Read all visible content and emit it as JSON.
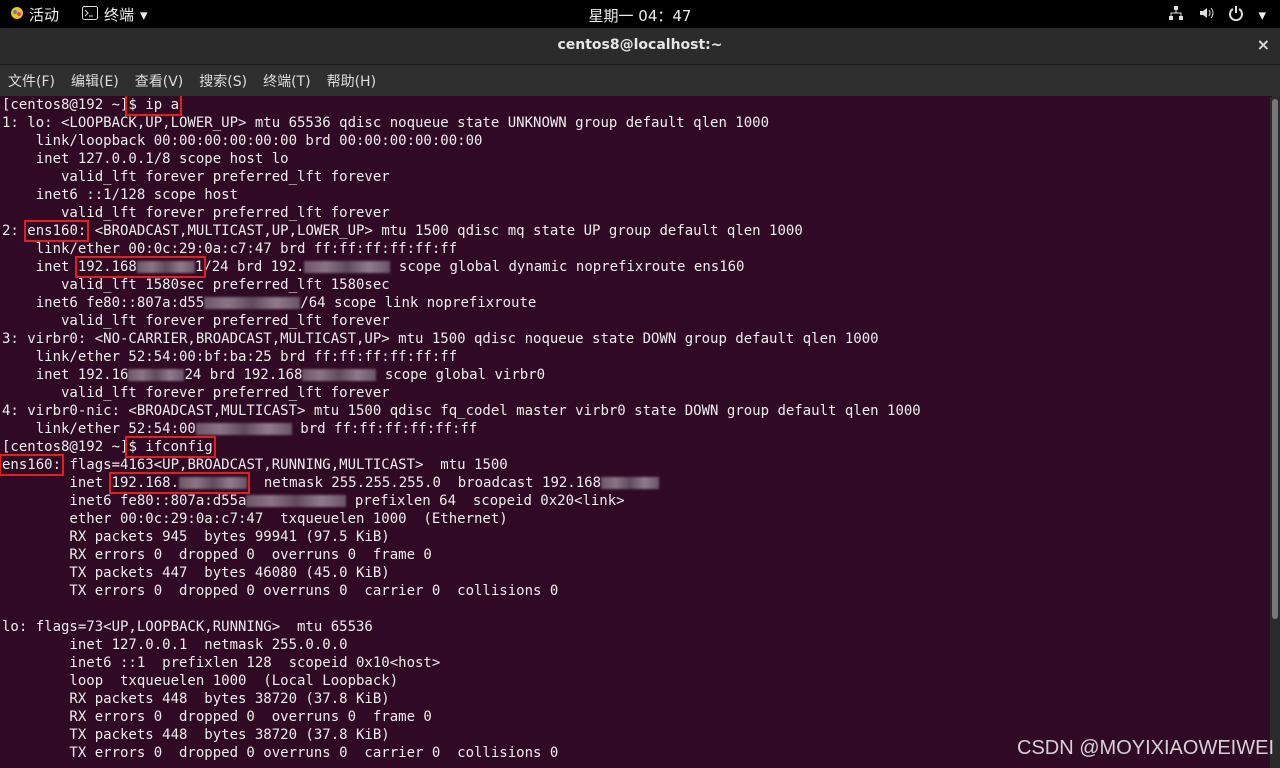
{
  "topbar": {
    "activities": "活动",
    "terminal_app": "终端",
    "clock": "星期一 04：47"
  },
  "window": {
    "title": "centos8@localhost:~",
    "close": "×"
  },
  "menu": [
    "文件(F)",
    "编辑(E)",
    "查看(V)",
    "搜索(S)",
    "终端(T)",
    "帮助(H)"
  ],
  "terminal": {
    "p1_prompt": "[centos8@192 ~]",
    "p1_cmd": "$ ip a",
    "l1": "1: lo: <LOOPBACK,UP,LOWER_UP> mtu 65536 qdisc noqueue state UNKNOWN group default qlen 1000",
    "l2": "    link/loopback 00:00:00:00:00:00 brd 00:00:00:00:00:00",
    "l3": "    inet 127.0.0.1/8 scope host lo",
    "l4": "       valid_lft forever preferred_lft forever",
    "l5": "    inet6 ::1/128 scope host",
    "l6": "       valid_lft forever preferred_lft forever",
    "l7a": "2: ",
    "l7b": "ens160:",
    "l7c": " <BROADCAST,MULTICAST,UP,LOWER_UP> mtu 1500 qdisc mq state UP group default qlen 1000",
    "l8": "    link/ether 00:0c:29:0a:c7:47 brd ff:ff:ff:ff:ff:ff",
    "l9a": "    inet ",
    "l9b": "192.168",
    "l9c": "1",
    "l9d": "/24 brd 192.",
    "l9e": " scope global dynamic noprefixroute ens160",
    "l10": "       valid_lft 1580sec preferred_lft 1580sec",
    "l11a": "    inet6 fe80::807a:d55",
    "l11b": "/64 scope link noprefixroute",
    "l12": "       valid_lft forever preferred_lft forever",
    "l13": "3: virbr0: <NO-CARRIER,BROADCAST,MULTICAST,UP> mtu 1500 qdisc noqueue state DOWN group default qlen 1000",
    "l14": "    link/ether 52:54:00:bf:ba:25 brd ff:ff:ff:ff:ff:ff",
    "l15a": "    inet 192.16",
    "l15b": "24 brd 192.168",
    "l15c": " scope global virbr0",
    "l16": "       valid_lft forever preferred_lft forever",
    "l17": "4: virbr0-nic: <BROADCAST,MULTICAST> mtu 1500 qdisc fq_codel master virbr0 state DOWN group default qlen 1000",
    "l18a": "    link/ether 52:54:00",
    "l18b": " brd ff:ff:ff:ff:ff:ff",
    "p2_prompt": "[centos8@192 ~]",
    "p2_cmd": "$ ifconfig",
    "e1a": "ens160:",
    "e1b": " flags=4163<UP,BROADCAST,RUNNING,MULTICAST>  mtu 1500",
    "e2a": "        inet ",
    "e2b": "192.168.",
    "e2c": "  netmask 255.255.255.0  broadcast 192.168",
    "e3a": "        inet6 fe80::807a:d55a",
    "e3b": " prefixlen 64  scopeid 0x20<link>",
    "e4": "        ether 00:0c:29:0a:c7:47  txqueuelen 1000  (Ethernet)",
    "e5": "        RX packets 945  bytes 99941 (97.5 KiB)",
    "e6": "        RX errors 0  dropped 0  overruns 0  frame 0",
    "e7": "        TX packets 447  bytes 46080 (45.0 KiB)",
    "e8": "        TX errors 0  dropped 0 overruns 0  carrier 0  collisions 0",
    "o1": "lo: flags=73<UP,LOOPBACK,RUNNING>  mtu 65536",
    "o2": "        inet 127.0.0.1  netmask 255.0.0.0",
    "o3": "        inet6 ::1  prefixlen 128  scopeid 0x10<host>",
    "o4": "        loop  txqueuelen 1000  (Local Loopback)",
    "o5": "        RX packets 448  bytes 38720 (37.8 KiB)",
    "o6": "        RX errors 0  dropped 0  overruns 0  frame 0",
    "o7": "        TX packets 448  bytes 38720 (37.8 KiB)",
    "o8": "        TX errors 0  dropped 0 overruns 0  carrier 0  collisions 0"
  },
  "watermark": "CSDN @MOYIXIAOWEIWEI",
  "colors": {
    "terminal_bg": "#300a24",
    "highlight": "#e02020",
    "topbar_bg": "#000000"
  }
}
